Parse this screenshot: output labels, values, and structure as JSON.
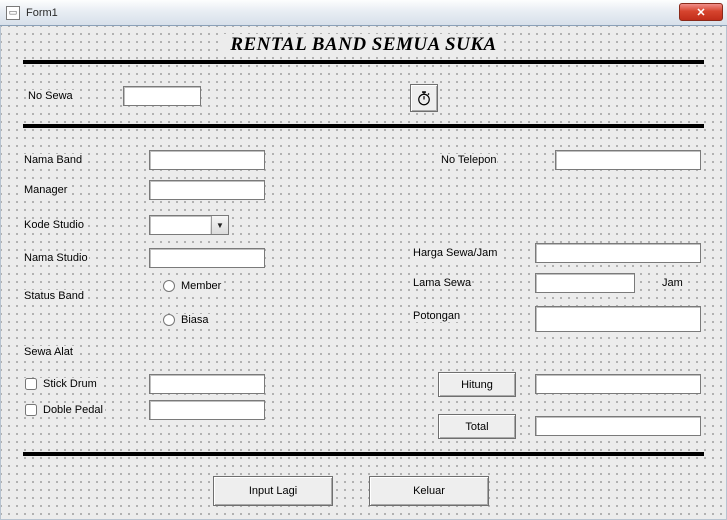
{
  "window": {
    "title": "Form1"
  },
  "heading": "RENTAL BAND SEMUA SUKA",
  "labels": {
    "no_sewa": "No Sewa",
    "nama_band": "Nama Band",
    "manager": "Manager",
    "kode_studio": "Kode Studio",
    "nama_studio": "Nama Studio",
    "status_band": "Status Band",
    "sewa_alat": "Sewa Alat",
    "no_telepon": "No Telepon",
    "harga_sewa_jam": "Harga Sewa/Jam",
    "lama_sewa": "Lama Sewa",
    "lama_sewa_unit": "Jam",
    "potongan": "Potongan"
  },
  "radios": {
    "member": "Member",
    "biasa": "Biasa"
  },
  "checkboxes": {
    "stick_drum": "Stick Drum",
    "doble_pedal": "Doble Pedal"
  },
  "buttons": {
    "hitung": "Hitung",
    "total": "Total",
    "input_lagi": "Input Lagi",
    "keluar": "Keluar"
  },
  "values": {
    "no_sewa": "",
    "nama_band": "",
    "manager": "",
    "kode_studio": "",
    "nama_studio": "",
    "no_telepon": "",
    "harga_sewa_jam": "",
    "lama_sewa": "",
    "potongan": "",
    "stick_drum_price": "",
    "doble_pedal_price": "",
    "hitung_result": "",
    "total_result": ""
  },
  "checked": {
    "stick_drum": false,
    "doble_pedal": false,
    "member": false,
    "biasa": false
  }
}
